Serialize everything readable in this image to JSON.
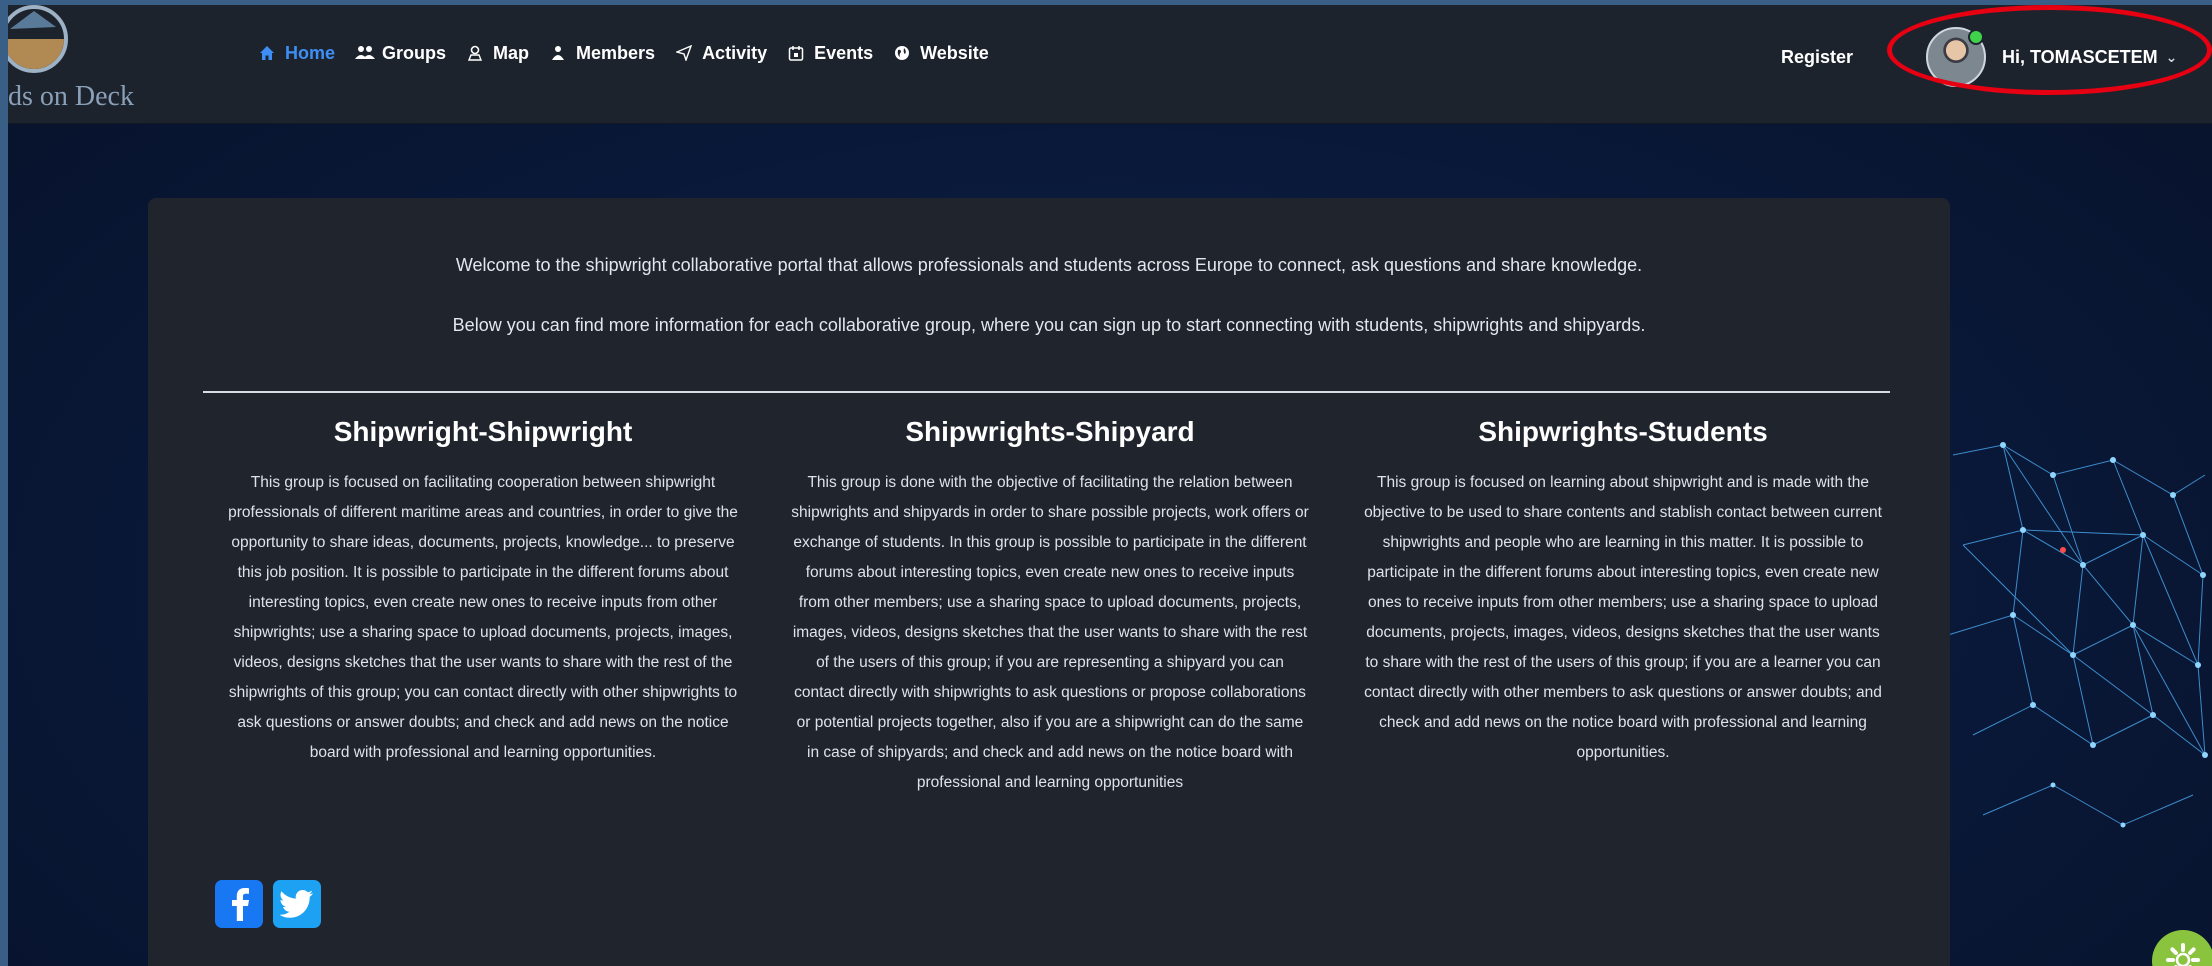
{
  "brand": {
    "logo_text": "ds on Deck"
  },
  "nav": {
    "items": [
      {
        "label": "Home",
        "icon": "home-icon",
        "active": true
      },
      {
        "label": "Groups",
        "icon": "groups-icon",
        "active": false
      },
      {
        "label": "Map",
        "icon": "map-icon",
        "active": false
      },
      {
        "label": "Members",
        "icon": "members-icon",
        "active": false
      },
      {
        "label": "Activity",
        "icon": "activity-icon",
        "active": false
      },
      {
        "label": "Events",
        "icon": "events-icon",
        "active": false
      },
      {
        "label": "Website",
        "icon": "globe-icon",
        "active": false
      }
    ],
    "register_label": "Register",
    "user_greeting": "Hi, TOMASCETEM"
  },
  "intro": {
    "line1": "Welcome to the shipwright collaborative portal that allows professionals and students across Europe to connect, ask questions and share knowledge.",
    "line2": "Below you can find more information for each collaborative group, where you can sign up to start connecting with students, shipwrights and shipyards."
  },
  "groups": [
    {
      "title": "Shipwright-Shipwright",
      "description": "This group is focused on facilitating cooperation between shipwright professionals of different maritime areas and countries, in order to give the opportunity to share ideas, documents, projects, knowledge... to preserve this job position. It is possible to participate in the different forums about interesting topics, even create new ones to receive inputs from other shipwrights; use a sharing space to upload documents, projects, images, videos, designs sketches that the user wants to share with the rest of the shipwrights of this group; you can contact directly with other shipwrights to ask questions or answer doubts; and check and add news on the notice board with professional and learning opportunities."
    },
    {
      "title": "Shipwrights-Shipyard",
      "description": "This group is done with the objective of facilitating the relation between shipwrights and shipyards in order to share possible projects, work offers or exchange of students. In this group is possible to participate in the different forums about interesting topics, even create new ones to receive inputs from other members; use a sharing space to upload documents, projects, images, videos, designs sketches that the user wants to share with the rest of the users of this group; if you are representing a shipyard you can contact directly with shipwrights to ask questions or propose collaborations or potential projects together, also if you are a shipwright can do the same in case of shipyards; and check and add news on the notice board with professional and learning opportunities"
    },
    {
      "title": "Shipwrights-Students",
      "description": "This group is focused on learning about shipwright and is made with the objective to be used to share contents and stablish contact between current shipwrights and people who are learning in this matter. It is possible to participate in the different forums about interesting topics, even create new ones to receive inputs from other members; use a sharing space to upload documents, projects, images, videos, designs sketches that the user wants to share with the rest of the users of this group; if you are a learner you can contact directly with other members to ask questions or answer doubts; and check and add news on the notice board with professional and learning opportunities."
    }
  ],
  "social": {
    "facebook_icon": "facebook-icon",
    "twitter_icon": "twitter-icon"
  },
  "colors": {
    "accent": "#3d8ff5",
    "navbar_bg": "#1d232d",
    "card_bg": "#1f242d",
    "highlight": "#e60012",
    "online": "#3fd24a",
    "fab": "#8ac43f"
  }
}
